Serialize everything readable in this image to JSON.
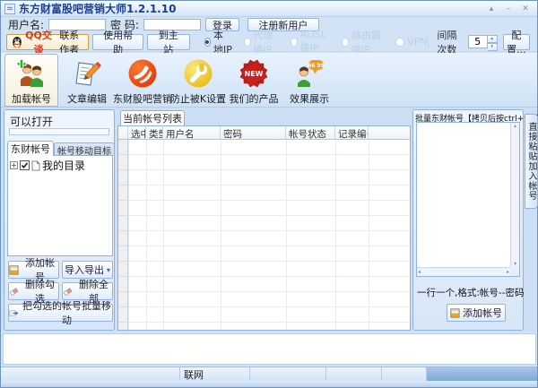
{
  "window": {
    "title": "东方财富股吧营销大师1.2.1.10",
    "rollup": "▴",
    "minimize": "–",
    "close": "✕"
  },
  "login": {
    "username_label": "用户名:",
    "password_label": "密 码:",
    "username_value": "",
    "password_value": "",
    "login_button": "登录",
    "register_button": "注册新用户"
  },
  "toolbar": {
    "qq_chat": "QQ交谈",
    "contact_author": "联系作者",
    "help_button": "使用帮助",
    "site_button": "到主站",
    "ip_options": [
      {
        "label": "本地IP",
        "selected": true,
        "enabled": true
      },
      {
        "label": "代理换IP",
        "selected": false,
        "enabled": false
      },
      {
        "label": "ADSL换IP",
        "selected": false,
        "enabled": false
      },
      {
        "label": "路由器换IP",
        "selected": false,
        "enabled": false
      },
      {
        "label": "VPN",
        "selected": false,
        "enabled": false
      }
    ],
    "interval_label": "间隔次数",
    "interval_value": "5",
    "config_button": "配置..."
  },
  "ribbon": {
    "items": [
      {
        "label": "加载帐号",
        "icon": "users-add-icon",
        "active": true
      },
      {
        "label": "文章编辑",
        "icon": "document-edit-icon",
        "active": false
      },
      {
        "label": "东财股吧营销",
        "icon": "eastmoney-logo-icon",
        "active": false
      },
      {
        "label": "防止被K设置",
        "icon": "wrench-icon",
        "active": false
      },
      {
        "label": "我们的产品",
        "icon": "new-badge-icon",
        "active": false
      },
      {
        "label": "效果展示",
        "icon": "quote-person-icon",
        "active": false
      }
    ]
  },
  "left_panel": {
    "open_label": "可以打开",
    "tabs": [
      {
        "label": "东财帐号",
        "active": true
      },
      {
        "label": "帐号移动目标",
        "active": false
      }
    ],
    "tree_root": "我的目录",
    "add_account": "添加帐号",
    "import_export": "导入导出",
    "delete_checked": "删除勾选",
    "delete_all": "删除全部",
    "batch_move": "把勾选的帐号批量移动"
  },
  "center_panel": {
    "tab": "当前帐号列表",
    "columns": [
      "选中",
      "类型",
      "用户名",
      "密码",
      "帐号状态",
      "记录编号"
    ],
    "rows": []
  },
  "right_panel": {
    "header": "批量东财帐号【拷贝后按ctrl+v粘贴】",
    "textarea_value": "",
    "hint": "一行一个,格式:帐号--密码",
    "add_button": "添加帐号",
    "side_tab": "直接粘贴加入帐号"
  },
  "status_bar": {
    "network": "联网"
  },
  "icons": {
    "caret_down": "▾",
    "spin_up": "▴",
    "spin_down": "▾",
    "scroll_up": "▴",
    "scroll_down": "▾",
    "scroll_left": "◂",
    "scroll_right": "▸",
    "tree_expand": "+",
    "check": "✓",
    "badge_text": "NEW",
    "quote_marks": "66 99"
  },
  "colors": {
    "title_text": "#1c3f94",
    "qq_red": "#d43b1e",
    "logo_orange": "#e8430f",
    "wrench_yellow": "#f0c419",
    "new_red": "#c9201d",
    "green": "#3c9e34",
    "accent_blue": "#7fa7d6"
  }
}
